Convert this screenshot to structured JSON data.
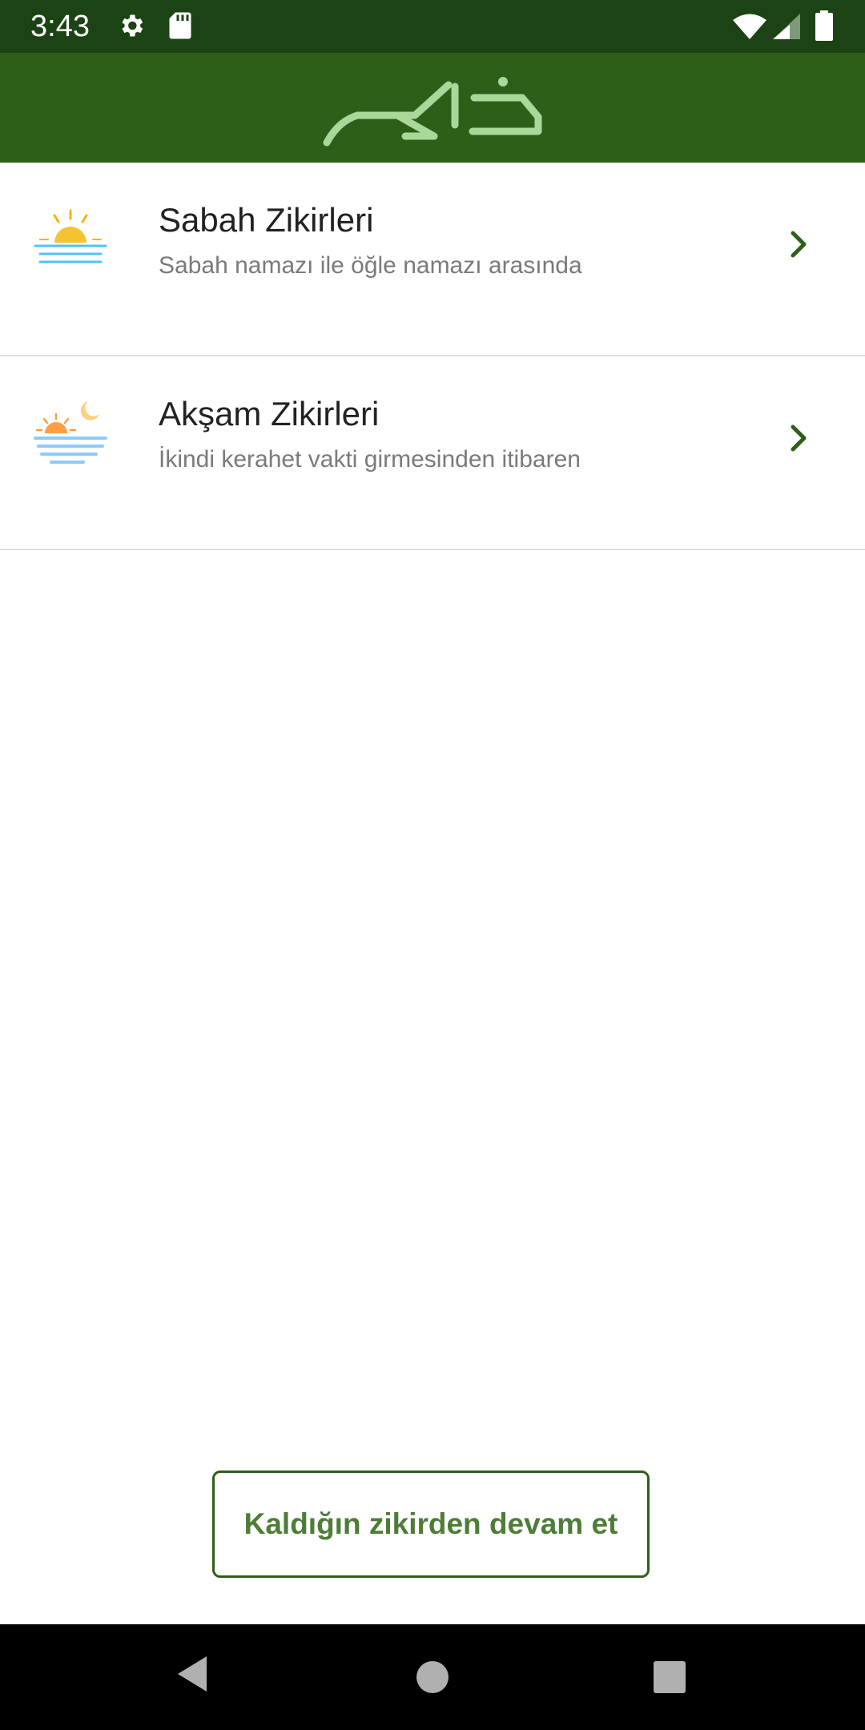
{
  "status_bar": {
    "time": "3:43",
    "icons": [
      "gear-icon",
      "sd-card-icon",
      "wifi-icon",
      "signal-icon",
      "battery-icon"
    ]
  },
  "app_bar": {
    "logo": "ذاكر",
    "color": "#2e5f19",
    "logo_color": "#a9d89a"
  },
  "list": {
    "items": [
      {
        "title": "Sabah Zikirleri",
        "subtitle": "Sabah namazı ile öğle namazı arasında",
        "icon": "sunrise-icon"
      },
      {
        "title": "Akşam Zikirleri",
        "subtitle": "İkindi kerahet vakti girmesinden itibaren",
        "icon": "sunset-moon-icon"
      }
    ]
  },
  "continue_button": {
    "label": "Kaldığın zikirden devam et"
  },
  "nav_bar": {
    "icons": [
      "back-icon",
      "home-icon",
      "recents-icon"
    ]
  }
}
